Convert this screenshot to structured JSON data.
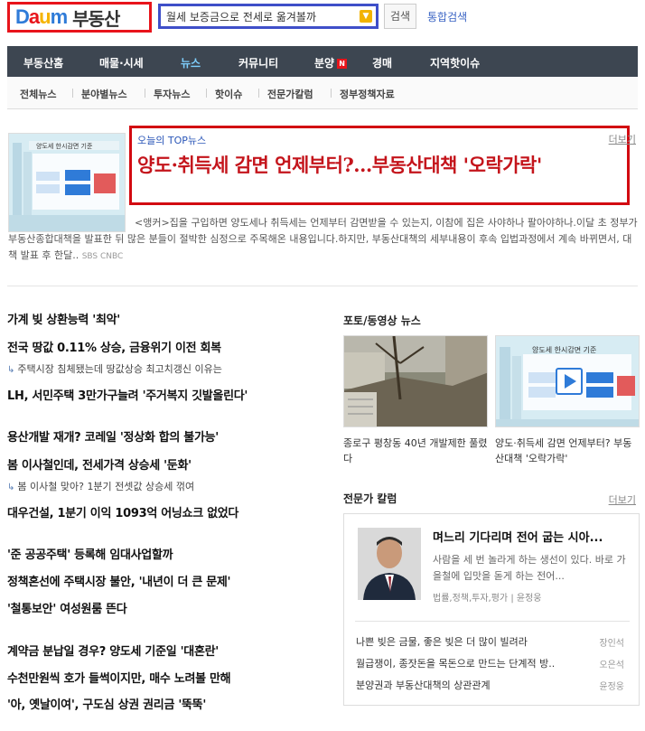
{
  "header": {
    "logo_letters": [
      "D",
      "a",
      "u",
      "m"
    ],
    "logo_colors": [
      "#2f7bd8",
      "#e8141b",
      "#f5b400",
      "#2f7bd8"
    ],
    "site_title": "부동산",
    "search_value": "월세 보증금으로 전세로 옮겨볼까",
    "search_button": "검색",
    "total_search": "통합검색"
  },
  "nav": {
    "items": [
      "부동산홈",
      "매물·시세",
      "뉴스",
      "커뮤니티",
      "분양",
      "경매",
      "지역핫이슈"
    ],
    "active": "뉴스",
    "badge": "N",
    "bg_color": "#3d4651"
  },
  "subnav": {
    "items": [
      "전체뉴스",
      "분야별뉴스",
      "투자뉴스",
      "핫이슈",
      "전문가칼럼",
      "정부정책자료"
    ]
  },
  "top_news": {
    "label": "오늘의 TOP뉴스",
    "more": "더보기",
    "title": "양도·취득세 감면 언제부터?…부동산대책 '오락가락'",
    "desc": "<앵커>집을 구입하면 양도세나 취득세는 언제부터 감면받을 수 있는지, 이참에 집은 사야하나 팔아야하나.이달 초 정부가 부동산종합대책을 발표한 뒤 많은 분들이 절박한 심정으로 주목해온 내용입니다.하지만, 부동산대책의 세부내용이 후속 입법과정에서 계속 바뀌면서, 대책 발표 후 한달..",
    "source": "SBS CNBC",
    "thumb_text": "양도세 한시감면 기준"
  },
  "news_list": [
    {
      "title": "가계 빚 상환능력 '최악'"
    },
    {
      "title": "전국 땅값 0.11% 상승, 금융위기 이전 회복"
    },
    {
      "sub": "주택시장 침체됐는데 땅값상승 최고치갱신 이유는"
    },
    {
      "title": "LH, 서민주택 3만가구늘려 '주거복지 깃발올린다'"
    },
    {
      "title": "용산개발 재개? 코레일 '정상화 합의 불가능'"
    },
    {
      "title": "봄 이사철인데, 전세가격 상승세 '둔화'"
    },
    {
      "sub": "봄 이사철 맞아? 1분기 전셋값 상승세 꺾여"
    },
    {
      "title": "대우건설, 1분기 이익 1093억 어닝쇼크 없었다"
    },
    {
      "title": "'준 공공주택' 등록해 임대사업할까"
    },
    {
      "title": "정책혼선에 주택시장 불안, '내년이 더 큰 문제'"
    },
    {
      "title": "'철통보안' 여성원룸 뜬다"
    },
    {
      "title": "계약금 분납일 경우? 양도세 기준일 '대혼란'"
    },
    {
      "title": "수천만원씩 호가 들썩이지만, 매수 노려볼 만해"
    },
    {
      "title": "'아, 옛날이여', 구도심 상권 권리금 '뚝뚝'"
    }
  ],
  "photo_news": {
    "title": "포토/동영상 뉴스",
    "items": [
      {
        "caption": "종로구 평창동 40년 개발제한 풀렸다"
      },
      {
        "caption": "양도·취득세 감면 언제부터? 부동산대책 '오락가락'",
        "thumb_text": "양도세 한시감면 기준"
      }
    ]
  },
  "expert_column": {
    "title": "전문가 칼럼",
    "more": "더보기",
    "featured": {
      "title": "며느리 기다리며 전어 굽는 시아...",
      "desc": "사람을 세 번 놀라게 하는 생선이 있다. 바로 가을철에 입맛을 돋게 하는 전어...",
      "tags": "법률,정책,투자,평가 | 윤정웅"
    },
    "items": [
      {
        "title": "나쁜 빚은 금물, 좋은 빚은 더 많이 빌려라",
        "author": "장인석"
      },
      {
        "title": "월급쟁이, 종잣돈을 목돈으로 만드는 단계적 방..",
        "author": "오은석"
      },
      {
        "title": "분양권과 부동산대책의 상관관계",
        "author": "윤정웅"
      }
    ]
  }
}
